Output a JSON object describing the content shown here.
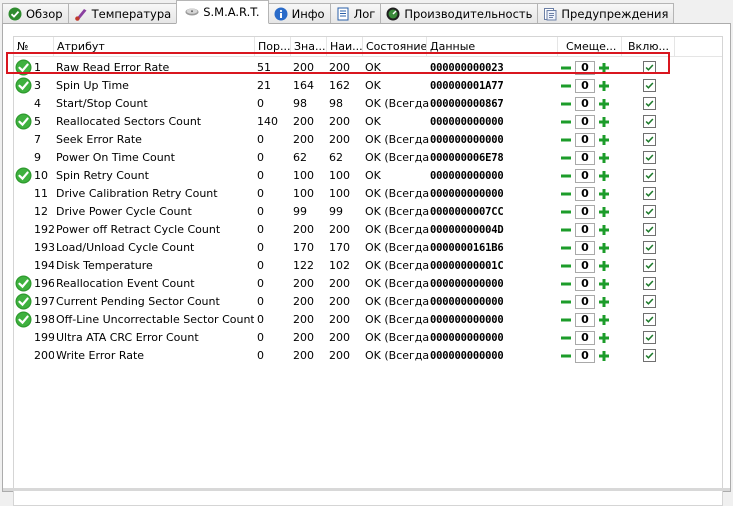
{
  "tabs": [
    {
      "label": "Обзор",
      "icon": "ok-check-icon"
    },
    {
      "label": "Температура",
      "icon": "thermometer-icon"
    },
    {
      "label": "S.M.A.R.T.",
      "icon": "hdd-icon"
    },
    {
      "label": "Инфо",
      "icon": "info-icon"
    },
    {
      "label": "Лог",
      "icon": "log-document-icon"
    },
    {
      "label": "Производительность",
      "icon": "gauge-icon"
    },
    {
      "label": "Предупреждения",
      "icon": "warnings-icon"
    }
  ],
  "active_tab": "S.M.A.R.T.",
  "columns": {
    "num": "№",
    "attribute": "Атрибут",
    "threshold": "Пор...",
    "value": "Зна...",
    "worst": "Наи...",
    "state": "Состояние",
    "data": "Данные",
    "offset": "Смеще...",
    "enabled": "Вклю..."
  },
  "rows": [
    {
      "ok": true,
      "num": "1",
      "name": "Raw Read Error Rate",
      "thr": "51",
      "val": "200",
      "worst": "200",
      "state": "OK",
      "data": "000000000023",
      "offset": "0"
    },
    {
      "ok": true,
      "num": "3",
      "name": "Spin Up Time",
      "thr": "21",
      "val": "164",
      "worst": "162",
      "state": "OK",
      "data": "000000001A77",
      "offset": "0"
    },
    {
      "ok": false,
      "num": "4",
      "name": "Start/Stop Count",
      "thr": "0",
      "val": "98",
      "worst": "98",
      "state": "OK (Всегда...",
      "data": "000000000867",
      "offset": "0"
    },
    {
      "ok": true,
      "num": "5",
      "name": "Reallocated Sectors Count",
      "thr": "140",
      "val": "200",
      "worst": "200",
      "state": "OK",
      "data": "000000000000",
      "offset": "0"
    },
    {
      "ok": false,
      "num": "7",
      "name": "Seek Error Rate",
      "thr": "0",
      "val": "200",
      "worst": "200",
      "state": "OK (Всегда...",
      "data": "000000000000",
      "offset": "0"
    },
    {
      "ok": false,
      "num": "9",
      "name": "Power On Time Count",
      "thr": "0",
      "val": "62",
      "worst": "62",
      "state": "OK (Всегда...",
      "data": "000000006E78",
      "offset": "0"
    },
    {
      "ok": true,
      "num": "10",
      "name": "Spin Retry Count",
      "thr": "0",
      "val": "100",
      "worst": "100",
      "state": "OK",
      "data": "000000000000",
      "offset": "0"
    },
    {
      "ok": false,
      "num": "11",
      "name": "Drive Calibration Retry Count",
      "thr": "0",
      "val": "100",
      "worst": "100",
      "state": "OK (Всегда...",
      "data": "000000000000",
      "offset": "0"
    },
    {
      "ok": false,
      "num": "12",
      "name": "Drive Power Cycle Count",
      "thr": "0",
      "val": "99",
      "worst": "99",
      "state": "OK (Всегда...",
      "data": "0000000007CC",
      "offset": "0"
    },
    {
      "ok": false,
      "num": "192",
      "name": "Power off Retract Cycle Count",
      "thr": "0",
      "val": "200",
      "worst": "200",
      "state": "OK (Всегда...",
      "data": "00000000004D",
      "offset": "0"
    },
    {
      "ok": false,
      "num": "193",
      "name": "Load/Unload Cycle Count",
      "thr": "0",
      "val": "170",
      "worst": "170",
      "state": "OK (Всегда...",
      "data": "0000000161B6",
      "offset": "0"
    },
    {
      "ok": false,
      "num": "194",
      "name": "Disk Temperature",
      "thr": "0",
      "val": "122",
      "worst": "102",
      "state": "OK (Всегда...",
      "data": "00000000001C",
      "offset": "0"
    },
    {
      "ok": true,
      "num": "196",
      "name": "Reallocation Event Count",
      "thr": "0",
      "val": "200",
      "worst": "200",
      "state": "OK (Всегда...",
      "data": "000000000000",
      "offset": "0"
    },
    {
      "ok": true,
      "num": "197",
      "name": "Current Pending Sector Count",
      "thr": "0",
      "val": "200",
      "worst": "200",
      "state": "OK (Всегда...",
      "data": "000000000000",
      "offset": "0"
    },
    {
      "ok": true,
      "num": "198",
      "name": "Off-Line Uncorrectable Sector Count",
      "thr": "0",
      "val": "200",
      "worst": "200",
      "state": "OK (Всегда...",
      "data": "000000000000",
      "offset": "0"
    },
    {
      "ok": false,
      "num": "199",
      "name": "Ultra ATA CRC Error Count",
      "thr": "0",
      "val": "200",
      "worst": "200",
      "state": "OK (Всегда...",
      "data": "000000000000",
      "offset": "0"
    },
    {
      "ok": false,
      "num": "200",
      "name": "Write Error Rate",
      "thr": "0",
      "val": "200",
      "worst": "200",
      "state": "OK (Всегда...",
      "data": "000000000000",
      "offset": "0"
    }
  ],
  "colors": {
    "ok_green": "#2e9a2e",
    "plus_green": "#1c9c2a",
    "highlight_red": "#d9161f"
  }
}
